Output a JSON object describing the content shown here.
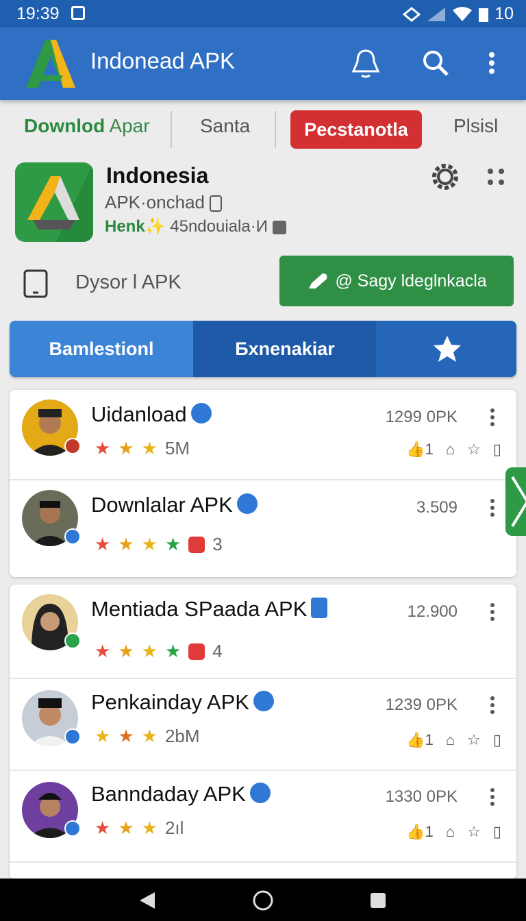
{
  "status": {
    "time": "19:39",
    "battery": "10"
  },
  "appbar": {
    "title": "Indonead APK"
  },
  "topnav": {
    "item1_bold": "Downlod",
    "item1_rest": "Apar",
    "item2": "Santa",
    "active": "Pecstanotla",
    "item4": "Plsisl"
  },
  "app": {
    "name": "Indonesia",
    "subtitle": "APK·onchad",
    "meta_bold": "Henk",
    "meta_rest": "45ndouiala·И"
  },
  "device": {
    "label": "Dysor l APK",
    "button": "@ Sagy ldeglnkacla"
  },
  "tabs": {
    "tab1": "Bamlestionl",
    "tab2": "Бxnenakiar"
  },
  "colors": {
    "primary": "#2f6fc4",
    "dark": "#1f5fb0",
    "green": "#2e8f45",
    "red": "#d33033"
  },
  "rows": [
    {
      "name": "Uidanload",
      "rating_text": "5M",
      "count": "1299 0PK",
      "like": "1"
    },
    {
      "name": "Downlalar APK",
      "rating_text": "3",
      "count": "3.509"
    },
    {
      "name": "Mentiada SPaada APK",
      "rating_text": "4",
      "count": "12.900"
    },
    {
      "name": "Penkainday APK",
      "rating_text": "2bM",
      "count": "1239 0PK",
      "like": "1"
    },
    {
      "name": "Banndaday APK",
      "rating_text": "2ıl",
      "count": "1330 0PK",
      "like": "1"
    }
  ]
}
